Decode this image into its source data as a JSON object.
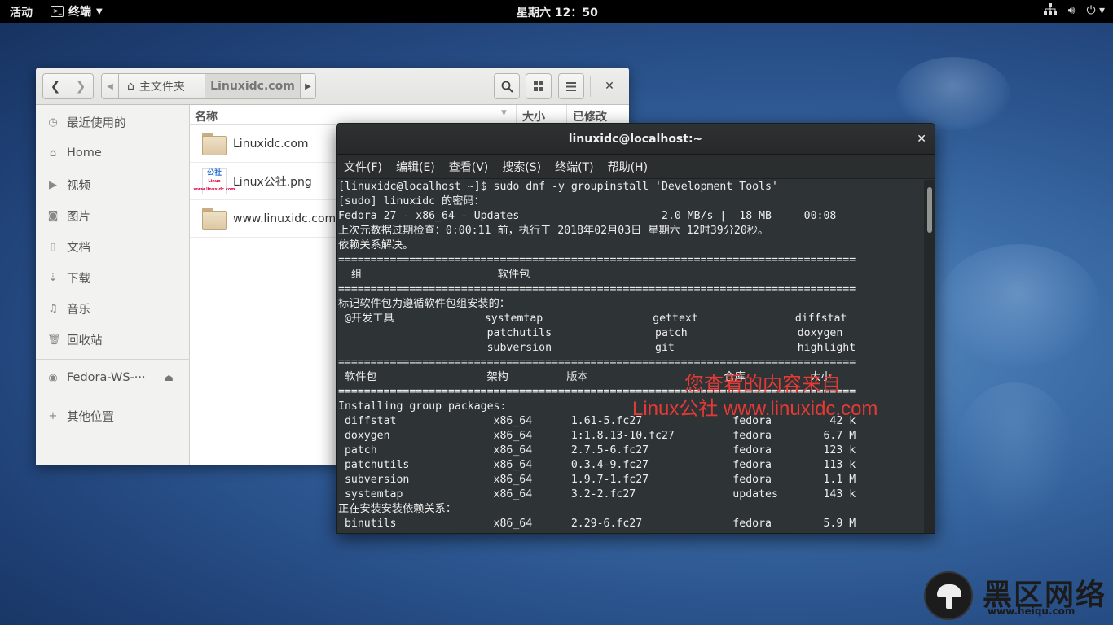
{
  "topbar": {
    "activities": "活动",
    "app_name": "终端",
    "clock": "星期六 12：50"
  },
  "files": {
    "path_home": "主文件夹",
    "path_current": "Linuxidc.com",
    "columns": {
      "name": "名称",
      "size": "大小",
      "modified": "已修改"
    },
    "sidebar": [
      {
        "label": "最近使用的",
        "icon": "clock-icon"
      },
      {
        "label": "Home",
        "icon": "home-icon"
      },
      {
        "label": "视频",
        "icon": "video-icon"
      },
      {
        "label": "图片",
        "icon": "camera-icon"
      },
      {
        "label": "文档",
        "icon": "document-icon"
      },
      {
        "label": "下载",
        "icon": "download-icon"
      },
      {
        "label": "音乐",
        "icon": "music-icon"
      },
      {
        "label": "回收站",
        "icon": "trash-icon"
      }
    ],
    "device": "Fedora-WS-···",
    "other_locations": "其他位置",
    "items": [
      {
        "name": "Linuxidc.com",
        "type": "folder"
      },
      {
        "name": "Linux公社.png",
        "type": "image",
        "thumb_text": "公社",
        "thumb_sub": "Linux",
        "thumb_url": "www.linuxidc.com"
      },
      {
        "name": "www.linuxidc.com",
        "type": "folder"
      }
    ]
  },
  "terminal": {
    "title": "linuxidc@localhost:~",
    "menu": [
      "文件(F)",
      "编辑(E)",
      "查看(V)",
      "搜索(S)",
      "终端(T)",
      "帮助(H)"
    ],
    "lines": [
      "[linuxidc@localhost ~]$ sudo dnf -y groupinstall 'Development Tools'",
      "[sudo] linuxidc 的密码：",
      "Fedora 27 - x86_64 - Updates                      2.0 MB/s |  18 MB     00:08",
      "上次元数据过期检查：0:00:11 前，执行于 2018年02月03日 星期六 12时39分20秒。",
      "依赖关系解决。",
      "================================================================================",
      "  组                     软件包",
      "================================================================================",
      "标记软件包为遵循软件包组安装的：",
      " @开发工具              systemtap                 gettext               diffstat",
      "                       patchutils                patch                 doxygen",
      "                       subversion                git                   highlight",
      "================================================================================",
      " 软件包                 架构         版本                     仓库          大小",
      "================================================================================",
      "Installing group packages:",
      " diffstat               x86_64      1.61-5.fc27              fedora         42 k",
      " doxygen                x86_64      1:1.8.13-10.fc27         fedora        6.7 M",
      " patch                  x86_64      2.7.5-6.fc27             fedora        123 k",
      " patchutils             x86_64      0.3.4-9.fc27             fedora        113 k",
      " subversion             x86_64      1.9.7-1.fc27             fedora        1.1 M",
      " systemtap              x86_64      3.2-2.fc27               updates       143 k",
      "正在安装安装依赖关系：",
      " binutils               x86_64      2.29-6.fc27              fedora        5.9 M"
    ]
  },
  "watermark": {
    "line1": "您查看的内容来自",
    "line2": "Linux公社 www.linuxidc.com"
  },
  "corner_logo": {
    "brand": "黑区网络",
    "url": "www.heiqu.com"
  }
}
